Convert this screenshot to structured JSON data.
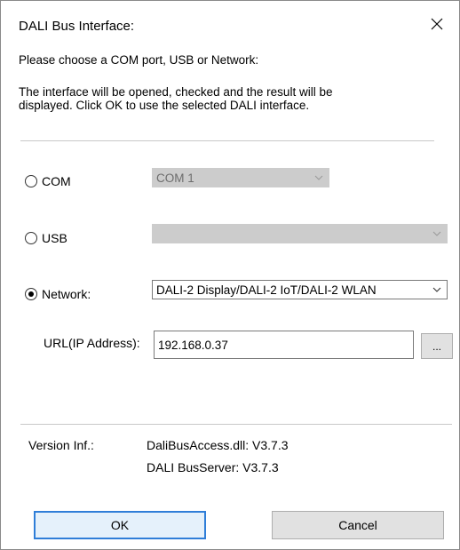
{
  "dialog": {
    "title": "DALI Bus Interface:",
    "instruction": "Please choose a COM port, USB or Network:",
    "description_line1": "The interface will be opened, checked and the result will be",
    "description_line2": "displayed. Click OK to use the selected DALI interface."
  },
  "options": {
    "com": {
      "label": "COM",
      "selected": false,
      "value": "COM 1",
      "enabled": false
    },
    "usb": {
      "label": "USB",
      "selected": false,
      "value": "",
      "enabled": false
    },
    "network": {
      "label": "Network:",
      "selected": true,
      "value": "DALI-2 Display/DALI-2 IoT/DALI-2 WLAN",
      "enabled": true
    }
  },
  "url": {
    "label": "URL(IP Address):",
    "value": "192.168.0.37",
    "browse_label": "..."
  },
  "version": {
    "label": "Version Inf.:",
    "line1": "DaliBusAccess.dll: V3.7.3",
    "line2": "DALI BusServer: V3.7.3"
  },
  "buttons": {
    "ok": "OK",
    "cancel": "Cancel"
  },
  "icons": {
    "close": "close-icon",
    "dropdown": "chevron-down-icon"
  },
  "colors": {
    "default_button_border": "#2f7ed8",
    "disabled_combo_bg": "#cccccc"
  }
}
